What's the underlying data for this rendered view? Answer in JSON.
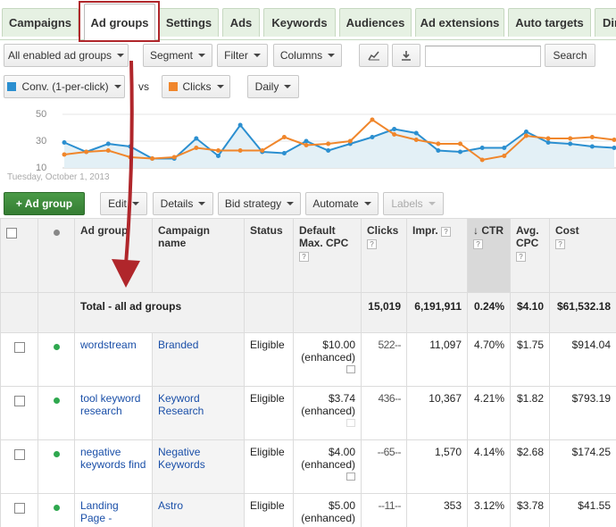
{
  "tabs": [
    "Campaigns",
    "Ad groups",
    "Settings",
    "Ads",
    "Keywords",
    "Audiences",
    "Ad extensions",
    "Auto targets",
    "Dim"
  ],
  "toolbar": {
    "filter_view": "All enabled ad groups",
    "segment": "Segment",
    "filter": "Filter",
    "columns": "Columns",
    "search": "Search",
    "search_value": ""
  },
  "chart_controls": {
    "metric1": "Conv. (1-per-click)",
    "metric1_color": "#2b8fd0",
    "vs": "vs",
    "metric2": "Clicks",
    "metric2_color": "#f0862b",
    "period": "Daily"
  },
  "chart_ticks": [
    "50",
    "30",
    "10"
  ],
  "chart_date": "Tuesday, October 1, 2013",
  "chart_data": {
    "type": "line",
    "ylim": [
      10,
      50
    ],
    "yticks": [
      50,
      30,
      10
    ],
    "series": [
      {
        "name": "Conv. (1-per-click)",
        "color": "#2b8fd0",
        "values": [
          29,
          22,
          28,
          26,
          17,
          17,
          32,
          19,
          42,
          22,
          21,
          30,
          23,
          28,
          33,
          39,
          36,
          23,
          22,
          25,
          25,
          37,
          29,
          28,
          26,
          25
        ]
      },
      {
        "name": "Clicks",
        "color": "#f0862b",
        "values": [
          20,
          22,
          23,
          18,
          17,
          18,
          25,
          23,
          23,
          23,
          33,
          27,
          28,
          30,
          46,
          35,
          31,
          28,
          28,
          16,
          19,
          34,
          32,
          32,
          33,
          31
        ]
      }
    ]
  },
  "actions": {
    "add": "+ Ad group",
    "edit": "Edit",
    "details": "Details",
    "bid_strategy": "Bid strategy",
    "automate": "Automate",
    "labels": "Labels"
  },
  "table": {
    "headers": {
      "ad_group": "Ad group",
      "campaign": "Campaign name",
      "status": "Status",
      "default_cpc": "Default Max. CPC",
      "clicks": "Clicks",
      "impr": "Impr.",
      "ctr": "CTR",
      "avg_cpc": "Avg. CPC",
      "cost": "Cost"
    },
    "total": {
      "label": "Total - all ad groups",
      "clicks": "15,019",
      "impr": "6,191,911",
      "ctr": "0.24%",
      "avg_cpc": "$4.10",
      "cost": "$61,532.18"
    },
    "rows": [
      {
        "ad_group": "wordstream",
        "campaign": "Branded",
        "status": "Eligible",
        "cpc": "$10.00",
        "cpc_note": "(enhanced)",
        "clicks": "522",
        "impr": "11,097",
        "ctr": "4.70%",
        "avg_cpc": "$1.75",
        "cost": "$914.04"
      },
      {
        "ad_group": "tool keyword research",
        "campaign": "Keyword Research",
        "status": "Eligible",
        "cpc": "$3.74",
        "cpc_note": "(enhanced)",
        "clicks": "436",
        "impr": "10,367",
        "ctr": "4.21%",
        "avg_cpc": "$1.82",
        "cost": "$793.19"
      },
      {
        "ad_group": "negative keywords find",
        "campaign": "Negative Keywords",
        "status": "Eligible",
        "cpc": "$4.00",
        "cpc_note": "(enhanced)",
        "clicks": "65",
        "impr": "1,570",
        "ctr": "4.14%",
        "avg_cpc": "$2.68",
        "cost": "$174.25"
      },
      {
        "ad_group": "Landing Page -",
        "campaign": "Astro",
        "status": "Eligible",
        "cpc": "$5.00",
        "cpc_note": "(enhanced)",
        "clicks": "11",
        "impr": "353",
        "ctr": "3.12%",
        "avg_cpc": "$3.78",
        "cost": "$41.55"
      }
    ]
  },
  "annotation_color": "#b0262b"
}
